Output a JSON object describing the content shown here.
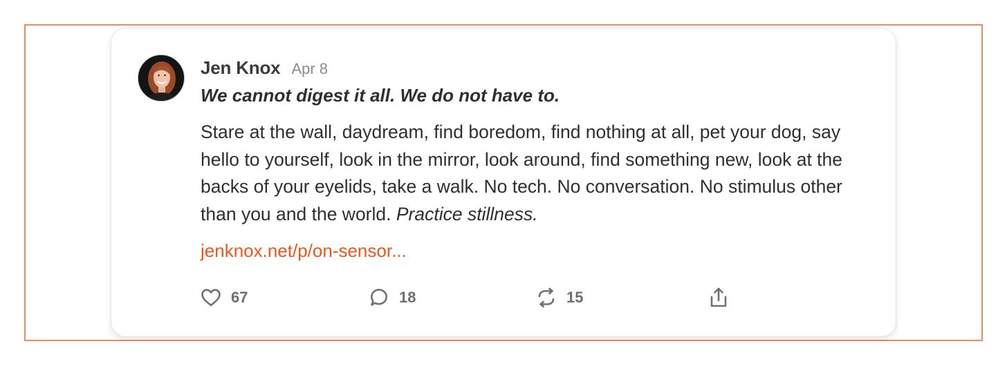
{
  "post": {
    "author": "Jen Knox",
    "date": "Apr 8",
    "title": "We cannot digest it all. We do not have to.",
    "body": "Stare at the wall, daydream, find boredom, find nothing at all, pet your dog, say hello to yourself, look in the mirror, look around, find something new, look at the backs of your eyelids, take a walk. No tech. No conversation. No stimulus other than you and the world. ",
    "body_emphasis": "Practice stillness.",
    "link": "jenknox.net/p/on-sensor..."
  },
  "actions": {
    "likes": "67",
    "comments": "18",
    "restacks": "15"
  },
  "colors": {
    "accent": "#f0561d",
    "frame": "#f28a5a",
    "icon": "#6f6f6f"
  },
  "icons": [
    "heart-icon",
    "comment-icon",
    "restack-icon",
    "share-icon"
  ]
}
